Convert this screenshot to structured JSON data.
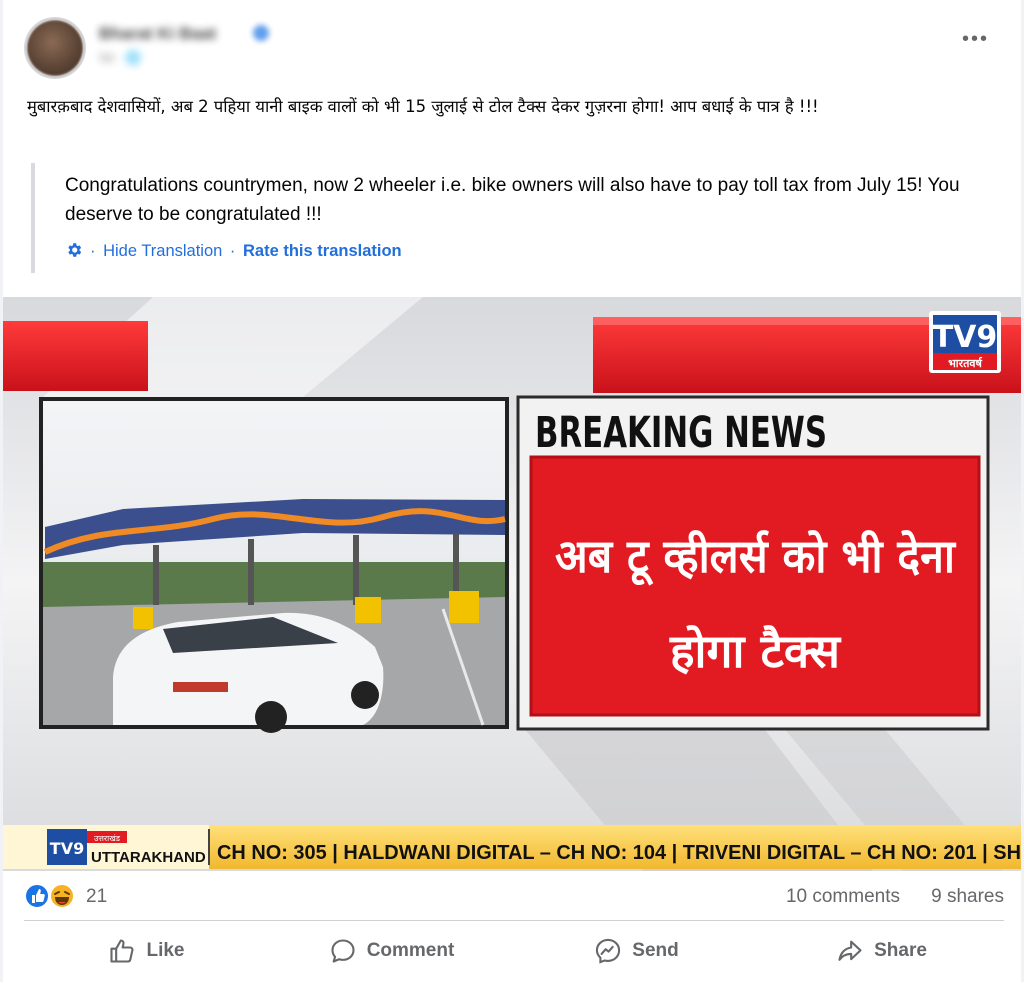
{
  "post": {
    "author_name": "Bharat Ki Baat",
    "meta_text": "5d · 🌐",
    "more_label": "•••",
    "text_hi": "मुबारक़बाद देशवासियों, अब 2 पहिया यानी बाइक वालों को भी 15 जुलाई से टोल टैक्स देकर गुज़रना होगा! आप बधाई के पात्र है !!!",
    "translation": "Congratulations countrymen, now 2 wheeler i.e. bike owners will also have to pay toll tax from July 15! You deserve to be congratulated !!!",
    "hide_translation": "Hide Translation",
    "separator": "·",
    "rate_translation": "Rate this translation"
  },
  "media": {
    "channel_logo": "TV9",
    "channel_sub": "भारतवर्ष",
    "breaking": "BREAKING NEWS",
    "headline_line1": "अब टू व्हीलर्स को भी देना",
    "headline_line2": "होगा टैक्स",
    "ticker_logo": "TV9",
    "ticker_tag": "उत्तराखंड",
    "ticker_region": "UTTARAKHAND",
    "ticker_text": "CH NO: 305 | HALDWANI DIGITAL – CH NO: 104 | TRIVENI DIGITAL – CH NO: 201 | SH"
  },
  "stats": {
    "reaction_count": "21",
    "comments": "10 comments",
    "shares": "9 shares"
  },
  "actions": {
    "like": "Like",
    "comment": "Comment",
    "send": "Send",
    "share": "Share"
  },
  "icons": [
    "more-icon",
    "gear-icon",
    "like-reaction-icon",
    "haha-reaction-icon",
    "thumbs-up-icon",
    "comment-icon",
    "messenger-icon",
    "share-arrow-icon"
  ],
  "colors": {
    "link_blue": "#216fdb",
    "breaking_red": "#e21b23",
    "ticker_yellow": "#f7c948",
    "text_gray": "#65676b"
  }
}
